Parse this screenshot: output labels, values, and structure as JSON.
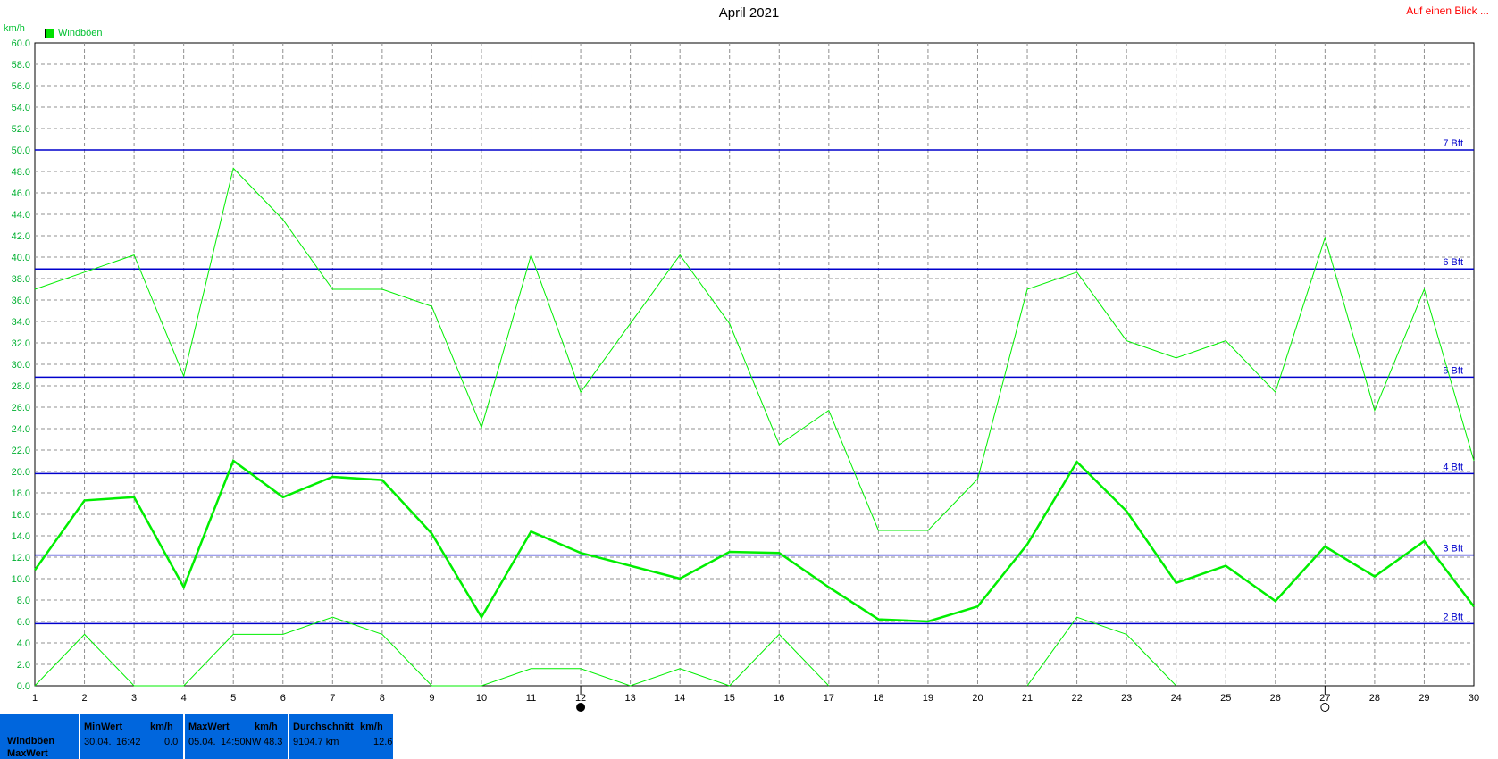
{
  "title": "April 2021",
  "top_link": "Auf einen Blick ...",
  "y_unit": "km/h",
  "legend_label": "Windböen",
  "colors": {
    "series": "#00ee00",
    "bft_line": "#0000cc",
    "panel": "#0066dd",
    "link": "#ff0000"
  },
  "chart_data": {
    "type": "line",
    "title": "April 2021",
    "ylabel": "km/h",
    "xlabel": "",
    "x": [
      1,
      2,
      3,
      4,
      5,
      6,
      7,
      8,
      9,
      10,
      11,
      12,
      13,
      14,
      15,
      16,
      17,
      18,
      19,
      20,
      21,
      22,
      23,
      24,
      25,
      26,
      27,
      28,
      29,
      30
    ],
    "ylim": [
      0,
      60
    ],
    "y_ticks": [
      "0.0",
      "2.0",
      "4.0",
      "6.0",
      "8.0",
      "10.0",
      "12.0",
      "14.0",
      "16.0",
      "18.0",
      "20.0",
      "22.0",
      "24.0",
      "26.0",
      "28.0",
      "30.0",
      "32.0",
      "34.0",
      "36.0",
      "38.0",
      "40.0",
      "42.0",
      "44.0",
      "46.0",
      "48.0",
      "50.0",
      "52.0",
      "54.0",
      "56.0",
      "58.0",
      "60.0"
    ],
    "grid": true,
    "legend_position": "top-left",
    "series": [
      {
        "name": "Windböen",
        "role": "max",
        "values": [
          37.0,
          38.6,
          40.2,
          28.9,
          48.3,
          43.5,
          37.0,
          37.0,
          35.4,
          24.1,
          40.2,
          27.4,
          33.8,
          40.2,
          33.8,
          22.5,
          25.7,
          14.5,
          14.5,
          19.3,
          37.0,
          38.6,
          32.2,
          30.6,
          32.2,
          27.4,
          41.8,
          25.7,
          37.0,
          21.0
        ]
      },
      {
        "name": "Windböen",
        "role": "mean",
        "values": [
          10.8,
          17.3,
          17.6,
          9.2,
          21.0,
          17.6,
          19.5,
          19.2,
          14.2,
          6.4,
          14.4,
          12.4,
          11.2,
          10.0,
          12.5,
          12.4,
          9.2,
          6.2,
          6.0,
          7.4,
          13.2,
          20.9,
          16.3,
          9.6,
          11.2,
          7.9,
          13.0,
          10.2,
          13.5,
          7.4
        ]
      },
      {
        "name": "Windböen",
        "role": "min",
        "values": [
          0.0,
          4.8,
          0.0,
          0.0,
          4.8,
          4.8,
          6.4,
          4.8,
          0.0,
          0.0,
          1.6,
          1.6,
          0.0,
          1.6,
          0.0,
          4.8,
          0.0,
          null,
          null,
          null,
          0.0,
          6.4,
          4.8,
          0.0,
          null,
          null,
          null,
          null,
          null,
          null
        ]
      }
    ],
    "reference_lines": [
      {
        "label": "2 Bft",
        "value": 5.8
      },
      {
        "label": "3 Bft",
        "value": 12.2
      },
      {
        "label": "4 Bft",
        "value": 19.8
      },
      {
        "label": "5 Bft",
        "value": 28.8
      },
      {
        "label": "6 Bft",
        "value": 38.9
      },
      {
        "label": "7 Bft",
        "value": 50.0
      }
    ],
    "markers": [
      {
        "day": 12,
        "icon": "new-moon-icon"
      },
      {
        "day": 27,
        "icon": "full-moon-icon"
      }
    ]
  },
  "stats": {
    "row_label": "Windböen",
    "row_label2": "MaxWert",
    "min": {
      "header": "MinWert",
      "unit": "km/h",
      "date": "30.04.",
      "time": "16:42",
      "value": "0.0"
    },
    "max": {
      "header": "MaxWert",
      "unit": "km/h",
      "date": "05.04.",
      "time": "14:50",
      "dir": "NW",
      "value": "48.3"
    },
    "avg": {
      "header": "Durchschnitt",
      "unit": "km/h",
      "distance": "9104.7 km",
      "value": "12.6"
    }
  }
}
